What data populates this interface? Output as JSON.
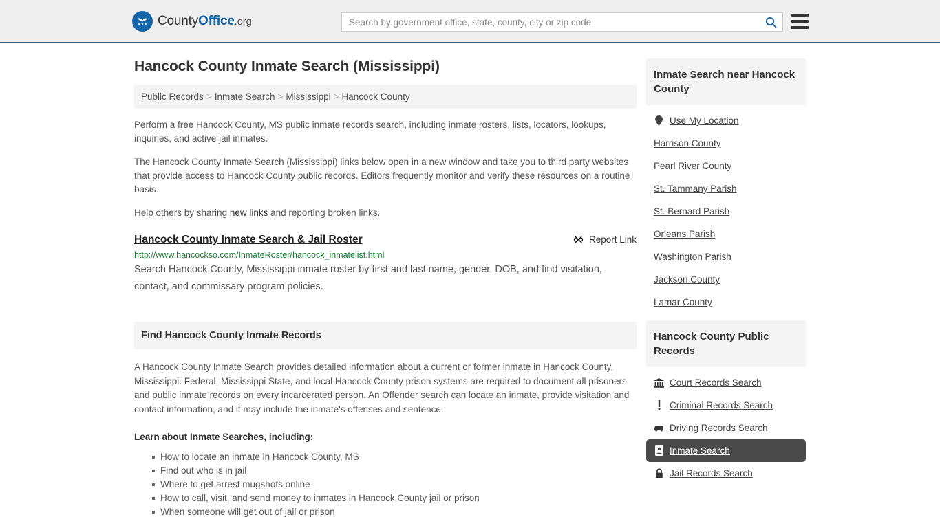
{
  "header": {
    "logo_name": "County",
    "logo_bold": "Office",
    "logo_suffix": ".org",
    "logo_icon": "eagle-seal-icon",
    "search_placeholder": "Search by government office, state, county, city or zip code",
    "search_value": "",
    "search_icon": "search-icon",
    "menu_icon": "hamburger-menu-icon"
  },
  "page": {
    "title": "Hancock County Inmate Search (Mississippi)"
  },
  "breadcrumb": {
    "items": [
      "Public Records",
      "Inmate Search",
      "Mississippi",
      "Hancock County"
    ],
    "separator": ">"
  },
  "intro": {
    "p1": "Perform a free Hancock County, MS public inmate records search, including inmate rosters, lists, locators, lookups, inquiries, and active jail inmates.",
    "p2": "The Hancock County Inmate Search (Mississippi) links below open in a new window and take you to third party websites that provide access to Hancock County public records. Editors frequently monitor and verify these resources on a routine basis.",
    "p3_before": "Help others by sharing ",
    "p3_link": "new links",
    "p3_after": " and reporting broken links."
  },
  "result": {
    "title": "Hancock County Inmate Search & Jail Roster",
    "report_label": "Report Link",
    "report_icon": "broken-link-icon",
    "url": "http://www.hancockso.com/InmateRoster/hancock_inmatelist.html",
    "description": "Search Hancock County, Mississippi inmate roster by first and last name, gender, DOB, and find visitation, contact, and commissary program policies."
  },
  "section": {
    "heading": "Find Hancock County Inmate Records",
    "body": "A Hancock County Inmate Search provides detailed information about a current or former inmate in Hancock County, Mississippi. Federal, Mississippi State, and local Hancock County prison systems are required to document all prisoners and public inmate records on every incarcerated person. An Offender search can locate an inmate, provide visitation and contact information, and it may include the inmate's offenses and sentence.",
    "learn_heading": "Learn about Inmate Searches, including:",
    "learn_items": [
      "How to locate an inmate in Hancock County, MS",
      "Find out who is in jail",
      "Where to get arrest mugshots online",
      "How to call, visit, and send money to inmates in Hancock County jail or prison",
      "When someone will get out of jail or prison"
    ]
  },
  "sidebar": {
    "nearby": {
      "heading": "Inmate Search near Hancock County",
      "items": [
        {
          "label": "Use My Location",
          "icon": "map-pin-icon",
          "active": false
        },
        {
          "label": "Harrison County",
          "icon": "",
          "active": false
        },
        {
          "label": "Pearl River County",
          "icon": "",
          "active": false
        },
        {
          "label": "St. Tammany Parish",
          "icon": "",
          "active": false
        },
        {
          "label": "St. Bernard Parish",
          "icon": "",
          "active": false
        },
        {
          "label": "Orleans Parish",
          "icon": "",
          "active": false
        },
        {
          "label": "Washington Parish",
          "icon": "",
          "active": false
        },
        {
          "label": "Jackson County",
          "icon": "",
          "active": false
        },
        {
          "label": "Lamar County",
          "icon": "",
          "active": false
        }
      ]
    },
    "public_records": {
      "heading": "Hancock County Public Records",
      "items": [
        {
          "label": "Court Records Search",
          "icon": "courthouse-icon",
          "active": false
        },
        {
          "label": "Criminal Records Search",
          "icon": "exclamation-icon",
          "active": false
        },
        {
          "label": "Driving Records Search",
          "icon": "car-icon",
          "active": false
        },
        {
          "label": "Inmate Search",
          "icon": "id-card-icon",
          "active": true
        },
        {
          "label": "Jail Records Search",
          "icon": "lock-icon",
          "active": false
        }
      ]
    }
  },
  "colors": {
    "header_bg": "#eeeeee",
    "header_border": "#2a6496",
    "brand_blue": "#1565a8",
    "panel_bg": "#f4f4f4",
    "active_bg": "#4a4a4a",
    "url_green": "#1e7b34"
  }
}
